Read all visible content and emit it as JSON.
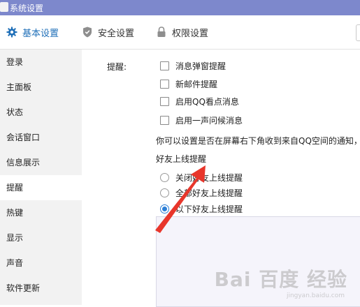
{
  "window": {
    "title": "系统设置"
  },
  "topnav": {
    "tabs": [
      {
        "label": "基本设置",
        "icon": "gear-icon",
        "active": true
      },
      {
        "label": "安全设置",
        "icon": "shield-icon",
        "active": false
      },
      {
        "label": "权限设置",
        "icon": "lock-icon",
        "active": false
      }
    ]
  },
  "sidebar": {
    "items": [
      {
        "label": "登录"
      },
      {
        "label": "主面板"
      },
      {
        "label": "状态"
      },
      {
        "label": "会话窗口"
      },
      {
        "label": "信息展示"
      },
      {
        "label": "提醒",
        "active": true
      },
      {
        "label": "热键"
      },
      {
        "label": "显示"
      },
      {
        "label": "声音"
      },
      {
        "label": "软件更新"
      }
    ]
  },
  "reminder": {
    "label": "提醒:",
    "checkboxes": [
      {
        "label": "消息弹窗提醒",
        "checked": false
      },
      {
        "label": "新邮件提醒",
        "checked": false
      },
      {
        "label": "启用QQ看点消息",
        "checked": false
      },
      {
        "label": "启用一声问候消息",
        "checked": false
      }
    ],
    "info_text": "你可以设置是否在屏幕右下角收到来自QQ空间的通知，"
  },
  "friend_online": {
    "title": "好友上线提醒",
    "options": [
      {
        "label": "关闭好友上线提醒",
        "checked": false
      },
      {
        "label": "全部好友上线提醒",
        "checked": false
      },
      {
        "label": "以下好友上线提醒",
        "checked": true
      }
    ]
  },
  "annotation": {
    "color": "#e8362b"
  },
  "watermark": {
    "text": "Bai 百度 经验",
    "sub": "jingyan.baidu.com"
  },
  "colors": {
    "titlebar": "#7d88cc",
    "accent": "#1f6fb8",
    "radio_checked": "#2d7fd6",
    "sidebar_bg": "#f2f2f2"
  }
}
